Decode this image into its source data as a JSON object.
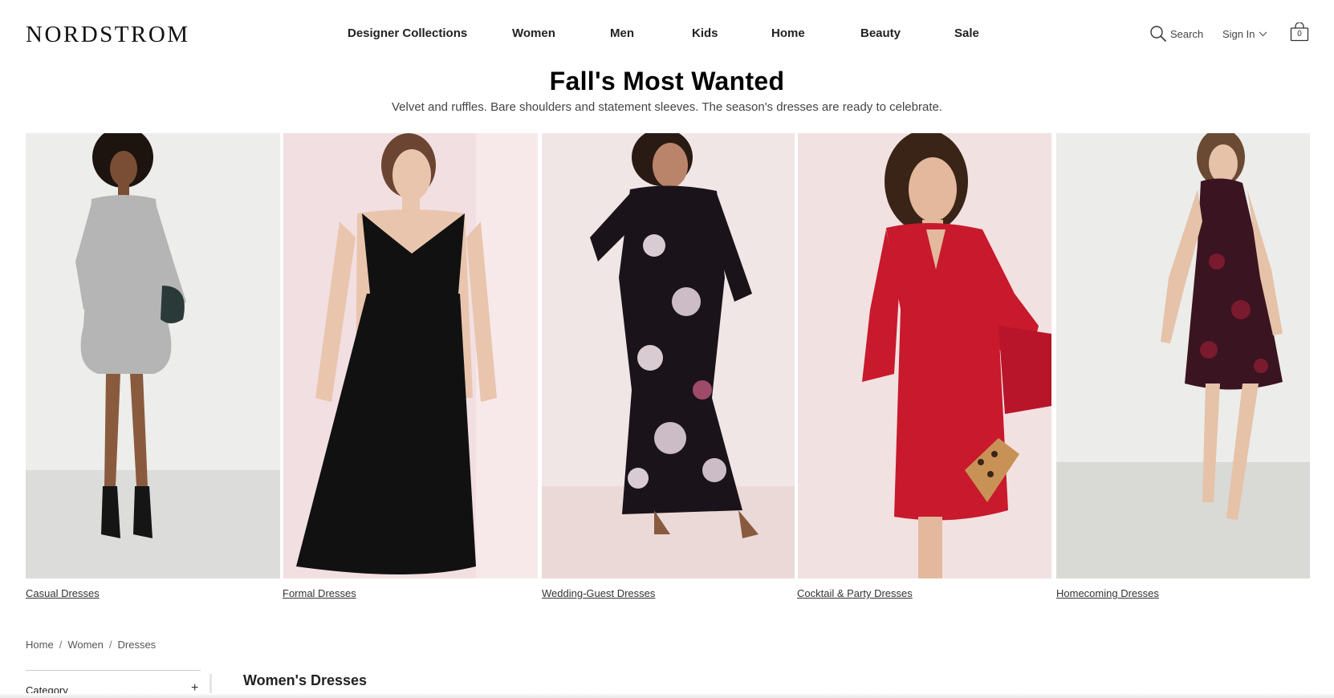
{
  "brand": {
    "name": "NORDSTROM"
  },
  "nav": {
    "items": [
      {
        "label": "Designer Collections"
      },
      {
        "label": "Women"
      },
      {
        "label": "Men"
      },
      {
        "label": "Kids"
      },
      {
        "label": "Home"
      },
      {
        "label": "Beauty"
      },
      {
        "label": "Sale"
      }
    ]
  },
  "utility": {
    "search_label": "Search",
    "search_icon": "search-icon",
    "signin_label": "Sign In",
    "signin_icon": "chevron-down-icon",
    "bag_icon": "shopping-bag-icon",
    "bag_count": "0"
  },
  "hero": {
    "title": "Fall's Most Wanted",
    "subtitle": "Velvet and ruffles. Bare shoulders and statement sleeves. The season's dresses are ready to celebrate."
  },
  "tiles": [
    {
      "label": "Casual Dresses",
      "image": "model-gray-ruffle-sleeve-dress",
      "bg": "#ededeb",
      "dress": "#b5b5b5"
    },
    {
      "label": "Formal Dresses",
      "image": "model-black-sleeveless-midi-dress",
      "bg": "#f2dfe1",
      "dress": "#111111"
    },
    {
      "label": "Wedding-Guest Dresses",
      "image": "model-black-floral-maxi-dress",
      "bg": "#f1e6e6",
      "dress": "#1a141a"
    },
    {
      "label": "Cocktail & Party Dresses",
      "image": "model-red-bell-sleeve-dress",
      "bg": "#f2e1e1",
      "dress": "#c8192d"
    },
    {
      "label": "Homecoming Dresses",
      "image": "model-burgundy-velvet-halter-dress",
      "bg": "#ececea",
      "dress": "#3a1420"
    }
  ],
  "breadcrumb": {
    "items": [
      {
        "label": "Home"
      },
      {
        "label": "Women"
      },
      {
        "label": "Dresses"
      }
    ],
    "separator": "/"
  },
  "filters": {
    "category_label": "Category",
    "expand_icon": "plus-icon",
    "expand_glyph": "+"
  },
  "results": {
    "title": "Women's Dresses"
  },
  "colors": {
    "text": "#222222",
    "muted": "#555555",
    "rule": "#cccccc"
  }
}
